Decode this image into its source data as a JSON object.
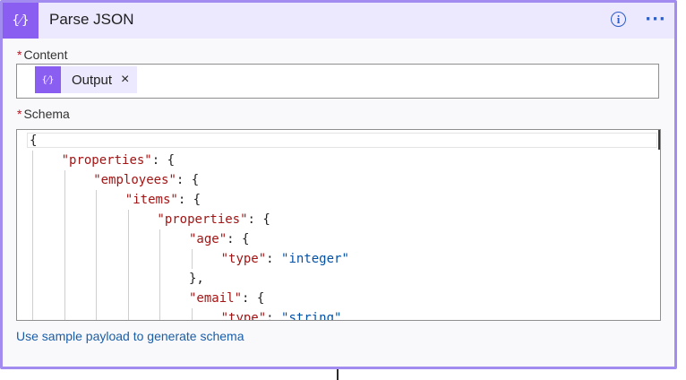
{
  "header": {
    "icon": "code-braces-icon",
    "icon_glyph": "{⁄}",
    "title": "Parse JSON",
    "info_icon": "info-icon",
    "info_glyph": "i",
    "more_icon": "more-options-icon",
    "more_glyph": "···"
  },
  "content": {
    "required_mark": "*",
    "label": "Content",
    "token": {
      "icon": "code-braces-icon",
      "icon_glyph": "{⁄}",
      "label": "Output",
      "remove_glyph": "×"
    }
  },
  "schema": {
    "required_mark": "*",
    "label": "Schema",
    "lines": [
      {
        "indent": 0,
        "parts": [
          {
            "t": "p",
            "s": "{"
          }
        ]
      },
      {
        "indent": 1,
        "parts": [
          {
            "t": "k",
            "s": "\"properties\""
          },
          {
            "t": "p",
            "s": ": {"
          }
        ]
      },
      {
        "indent": 2,
        "parts": [
          {
            "t": "k",
            "s": "\"employees\""
          },
          {
            "t": "p",
            "s": ": {"
          }
        ]
      },
      {
        "indent": 3,
        "parts": [
          {
            "t": "k",
            "s": "\"items\""
          },
          {
            "t": "p",
            "s": ": {"
          }
        ]
      },
      {
        "indent": 4,
        "parts": [
          {
            "t": "k",
            "s": "\"properties\""
          },
          {
            "t": "p",
            "s": ": {"
          }
        ]
      },
      {
        "indent": 5,
        "parts": [
          {
            "t": "k",
            "s": "\"age\""
          },
          {
            "t": "p",
            "s": ": {"
          }
        ]
      },
      {
        "indent": 6,
        "parts": [
          {
            "t": "k",
            "s": "\"type\""
          },
          {
            "t": "p",
            "s": ": "
          },
          {
            "t": "v",
            "s": "\"integer\""
          }
        ]
      },
      {
        "indent": 5,
        "parts": [
          {
            "t": "p",
            "s": "},"
          }
        ]
      },
      {
        "indent": 5,
        "parts": [
          {
            "t": "k",
            "s": "\"email\""
          },
          {
            "t": "p",
            "s": ": {"
          }
        ]
      },
      {
        "indent": 6,
        "parts": [
          {
            "t": "k",
            "s": "\"type\""
          },
          {
            "t": "p",
            "s": ": "
          },
          {
            "t": "v",
            "s": "\"string\""
          }
        ]
      }
    ]
  },
  "link_text": "Use sample payload to generate schema",
  "colors": {
    "accent": "#8a5ef0",
    "header_bg": "#ece8fd",
    "border": "#a28cf0",
    "json_key": "#a31515",
    "json_value": "#0451a5",
    "link": "#1b5ea8",
    "required": "#c50f1f"
  }
}
